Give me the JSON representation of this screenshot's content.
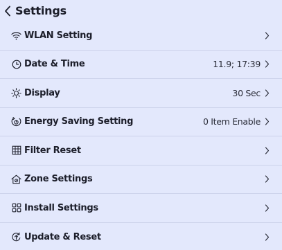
{
  "header": {
    "title": "Settings"
  },
  "items": [
    {
      "label": "WLAN Setting",
      "value": "",
      "icon": "wifi-icon"
    },
    {
      "label": "Date & Time",
      "value": "11.9; 17:39",
      "icon": "clock-icon"
    },
    {
      "label": "Display",
      "value": "30 Sec",
      "icon": "sun-icon"
    },
    {
      "label": "Energy Saving Setting",
      "value": "0 Item Enable",
      "icon": "energy-icon"
    },
    {
      "label": "Filter Reset",
      "value": "",
      "icon": "filter-grid-icon"
    },
    {
      "label": "Zone Settings",
      "value": "",
      "icon": "home-icon"
    },
    {
      "label": "Install Settings",
      "value": "",
      "icon": "install-grid-icon"
    },
    {
      "label": "Update & Reset",
      "value": "",
      "icon": "update-icon"
    }
  ],
  "colors": {
    "background": "#e3e8fc",
    "divider": "#ccd2ea",
    "text": "#1c1e2a"
  }
}
